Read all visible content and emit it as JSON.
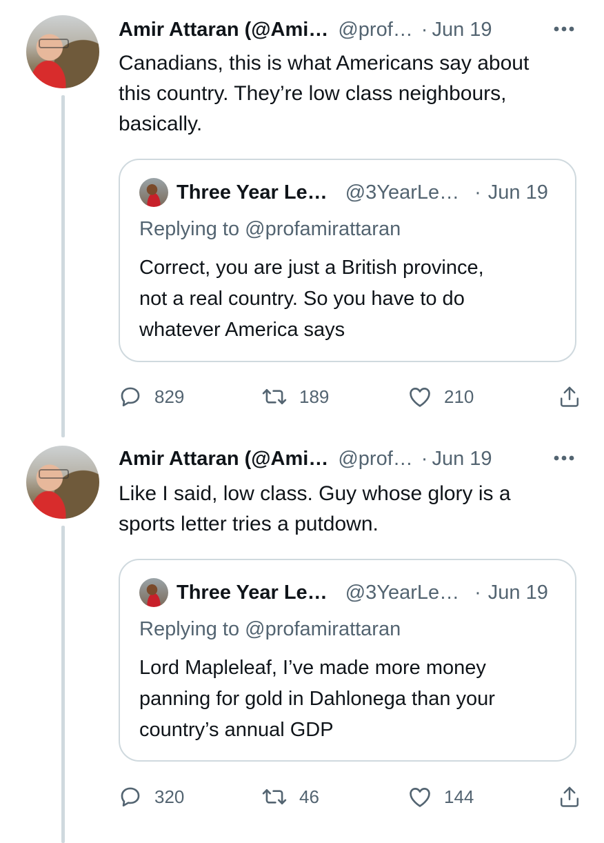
{
  "tweets": [
    {
      "author_name": "Amir Attaran (@Ami…",
      "author_handle": "@prof…",
      "separator": "·",
      "date": "Jun 19",
      "text": "Canadians, this is what Americans say about\nthis country.  They’re low class neighbours,\nbasically.",
      "quote": {
        "author_name": "Three Year Le…",
        "author_handle": "@3YearLe…",
        "separator": "·",
        "date": "Jun 19",
        "replying_to": "Replying to @profamirattaran",
        "text": "Correct, you are just a British province,\nnot a real country. So you have to do\nwhatever America says"
      },
      "replies": "829",
      "retweets": "189",
      "likes": "210"
    },
    {
      "author_name": "Amir Attaran (@Ami…",
      "author_handle": "@prof…",
      "separator": "·",
      "date": "Jun 19",
      "text": "Like I said, low class.  Guy whose glory is a\nsports letter tries a putdown.",
      "quote": {
        "author_name": "Three Year Le…",
        "author_handle": "@3YearLe…",
        "separator": "·",
        "date": "Jun 19",
        "replying_to": "Replying to @profamirattaran",
        "text": "Lord Mapleleaf, I’ve made more money\npanning for gold in Dahlonega than your\ncountry’s annual GDP"
      },
      "replies": "320",
      "retweets": "46",
      "likes": "144"
    }
  ],
  "icons": {
    "more": "more-horizontal-icon",
    "reply": "reply-bubble-icon",
    "retweet": "retweet-arrows-icon",
    "like": "heart-icon",
    "share": "share-upload-icon"
  },
  "colors": {
    "text_primary": "#0f1419",
    "text_secondary": "#536471",
    "border": "#cfd9de",
    "thread_line": "#cfd9de"
  }
}
